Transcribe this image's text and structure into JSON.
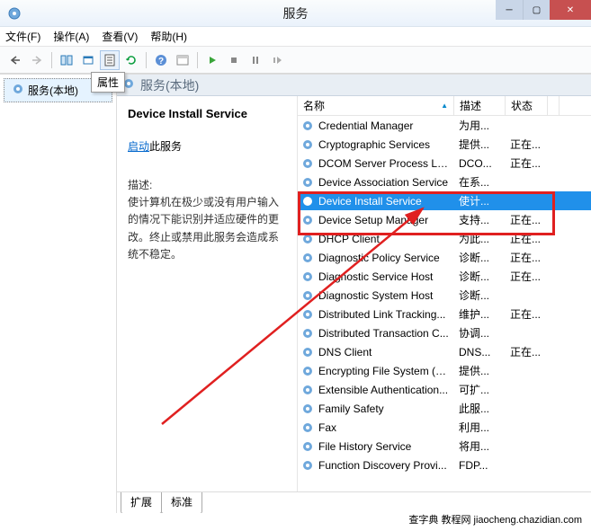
{
  "window": {
    "title": "服务"
  },
  "menubar": {
    "file": "文件(F)",
    "action": "操作(A)",
    "view": "查看(V)",
    "help": "帮助(H)"
  },
  "toolbar": {
    "tooltip": "属性"
  },
  "left_pane": {
    "item": "服务(本地)"
  },
  "right_header": {
    "title": "服务(本地)"
  },
  "detail": {
    "title": "Device Install Service",
    "start_link": "启动",
    "start_suffix": "此服务",
    "desc_label": "描述:",
    "desc": "使计算机在极少或没有用户输入的情况下能识别并适应硬件的更改。终止或禁用此服务会造成系统不稳定。"
  },
  "table": {
    "col_name": "名称",
    "col_desc": "描述",
    "col_status": "状态",
    "rows": [
      {
        "name": "Credential Manager",
        "desc": "为用...",
        "status": ""
      },
      {
        "name": "Cryptographic Services",
        "desc": "提供...",
        "status": "正在..."
      },
      {
        "name": "DCOM Server Process La...",
        "desc": "DCO...",
        "status": "正在..."
      },
      {
        "name": "Device Association Service",
        "desc": "在系...",
        "status": ""
      },
      {
        "name": "Device Install Service",
        "desc": "使计...",
        "status": "",
        "selected": true
      },
      {
        "name": "Device Setup Manager",
        "desc": "支持...",
        "status": "正在..."
      },
      {
        "name": "DHCP Client",
        "desc": "为此...",
        "status": "正在..."
      },
      {
        "name": "Diagnostic Policy Service",
        "desc": "诊断...",
        "status": "正在..."
      },
      {
        "name": "Diagnostic Service Host",
        "desc": "诊断...",
        "status": "正在..."
      },
      {
        "name": "Diagnostic System Host",
        "desc": "诊断...",
        "status": ""
      },
      {
        "name": "Distributed Link Tracking...",
        "desc": "维护...",
        "status": "正在..."
      },
      {
        "name": "Distributed Transaction C...",
        "desc": "协调...",
        "status": ""
      },
      {
        "name": "DNS Client",
        "desc": "DNS...",
        "status": "正在..."
      },
      {
        "name": "Encrypting File System (E...",
        "desc": "提供...",
        "status": ""
      },
      {
        "name": "Extensible Authentication...",
        "desc": "可扩...",
        "status": ""
      },
      {
        "name": "Family Safety",
        "desc": "此服...",
        "status": ""
      },
      {
        "name": "Fax",
        "desc": "利用...",
        "status": ""
      },
      {
        "name": "File History Service",
        "desc": "将用...",
        "status": ""
      },
      {
        "name": "Function Discovery Provi...",
        "desc": "FDP...",
        "status": ""
      }
    ]
  },
  "tabs": {
    "extended": "扩展",
    "standard": "标准"
  },
  "watermark": "查字典 教程网 jiaocheng.chazidian.com"
}
